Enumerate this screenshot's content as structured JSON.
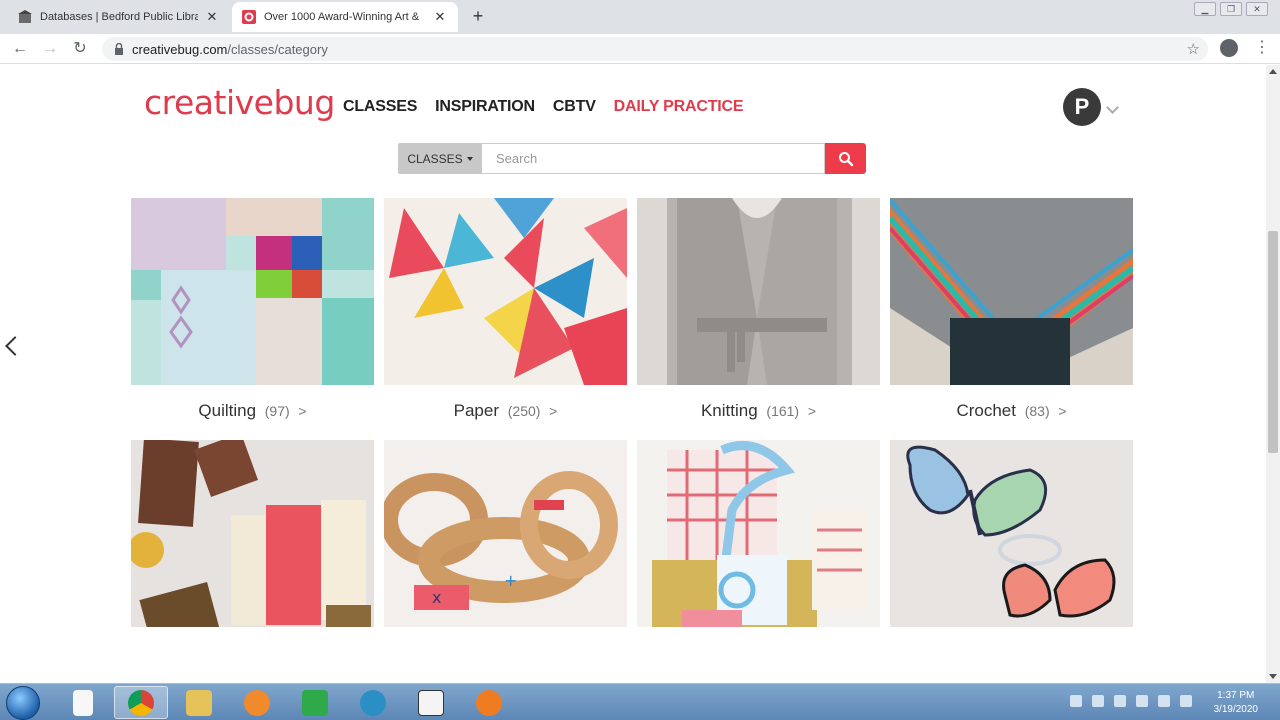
{
  "browser": {
    "tabs": [
      {
        "title": "Databases | Bedford Public Libra",
        "active": false
      },
      {
        "title": "Over 1000 Award-Winning Art &",
        "active": true
      }
    ],
    "url_host": "creativebug.com",
    "url_path": "/classes/category"
  },
  "site": {
    "logo": "creativebug",
    "nav": [
      "CLASSES",
      "INSPIRATION",
      "CBTV",
      "DAILY PRACTICE"
    ],
    "avatar_letter": "P",
    "search": {
      "category": "CLASSES",
      "placeholder": "Search"
    }
  },
  "categories": [
    {
      "name": "Quilting",
      "count": "(97)",
      "arrow": ">"
    },
    {
      "name": "Paper",
      "count": "(250)",
      "arrow": ">"
    },
    {
      "name": "Knitting",
      "count": "(161)",
      "arrow": ">"
    },
    {
      "name": "Crochet",
      "count": "(83)",
      "arrow": ">"
    }
  ],
  "taskbar": {
    "time": "1:37 PM",
    "date": "3/19/2020"
  },
  "colors": {
    "brand": "#e03b4c",
    "search_button": "#ee3b4a"
  }
}
